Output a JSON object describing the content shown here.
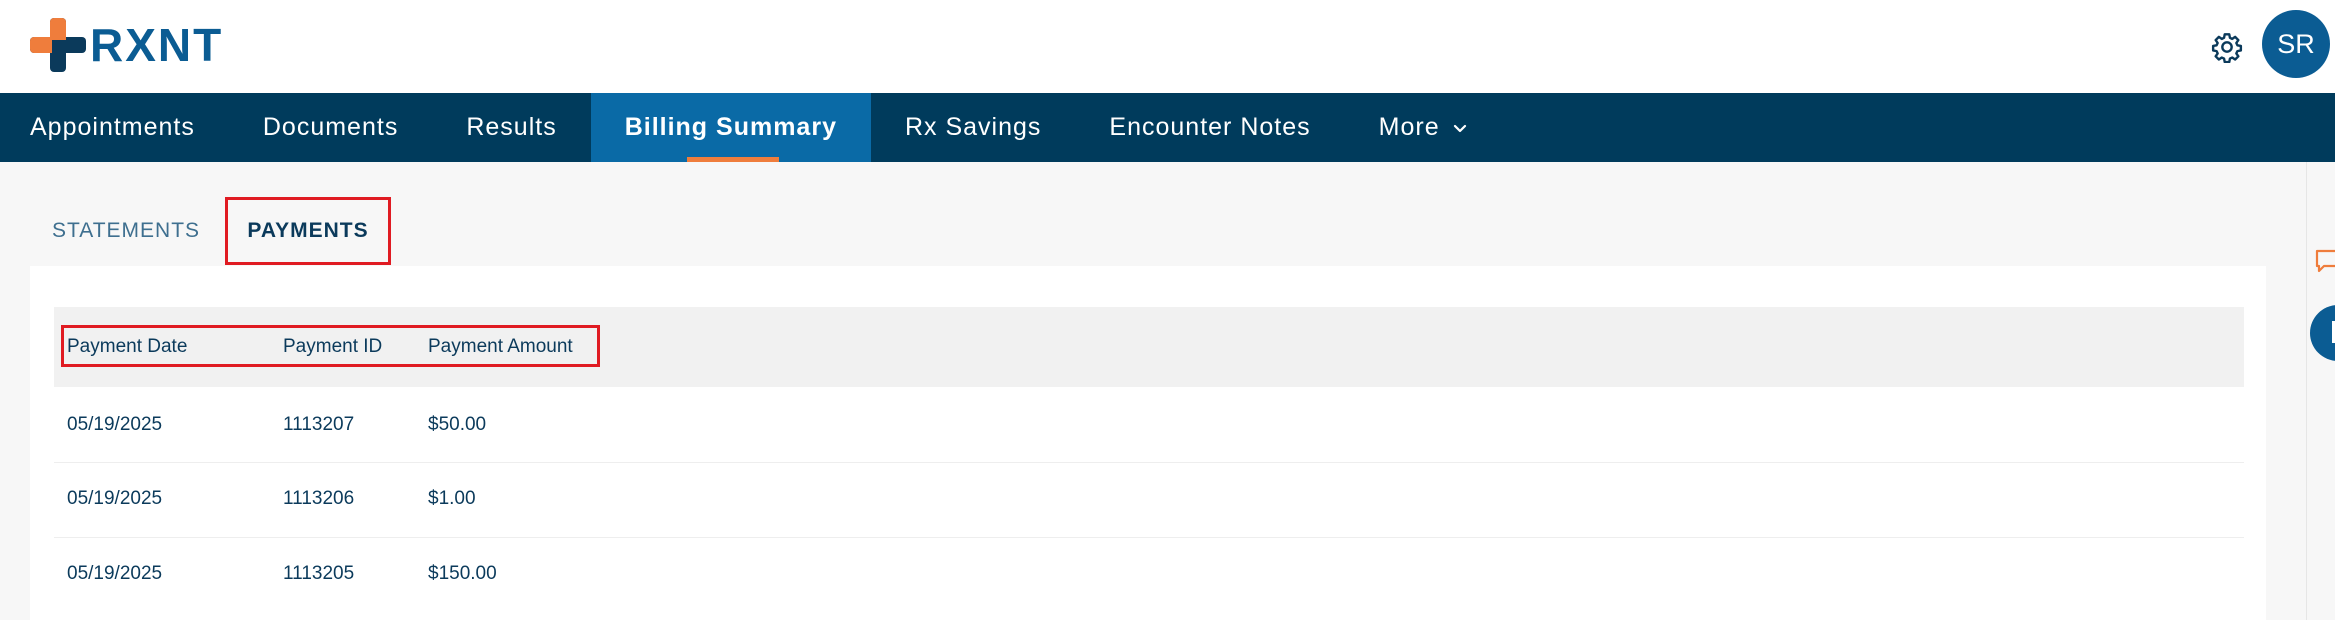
{
  "header": {
    "logo_text": "RXNT",
    "avatar_initials": "SR",
    "settings_icon": "gear-icon"
  },
  "colors": {
    "nav_bg": "#003b5c",
    "nav_active": "#0a6aa6",
    "accent": "#ef7d3c",
    "brand": "#0b5c93",
    "highlight": "#e01b22"
  },
  "nav": {
    "items": [
      {
        "label": "Appointments"
      },
      {
        "label": "Documents"
      },
      {
        "label": "Results"
      },
      {
        "label": "Billing Summary"
      },
      {
        "label": "Rx Savings"
      },
      {
        "label": "Encounter Notes"
      },
      {
        "label": "More"
      }
    ],
    "active": "Billing Summary"
  },
  "tabs": {
    "statements": "STATEMENTS",
    "payments": "PAYMENTS",
    "active": "PAYMENTS"
  },
  "table": {
    "headers": [
      "Payment Date",
      "Payment ID",
      "Payment Amount"
    ],
    "rows": [
      [
        "05/19/2025",
        "1113207",
        "$50.00"
      ],
      [
        "05/19/2025",
        "1113206",
        "$1.00"
      ],
      [
        "05/19/2025",
        "1113205",
        "$150.00"
      ]
    ]
  }
}
